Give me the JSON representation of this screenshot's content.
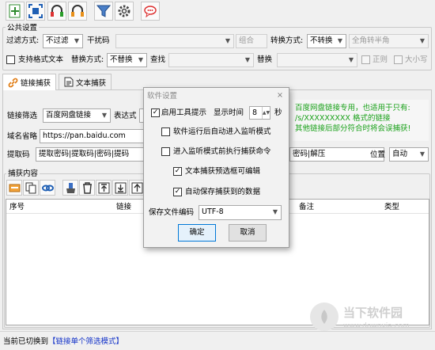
{
  "toolbar": {
    "icons": [
      "add-icon",
      "scan-icon",
      "headphones-red-icon",
      "headphones-orange-icon",
      "filter-icon",
      "gear-icon",
      "chat-icon"
    ]
  },
  "public_settings": {
    "title": "公共设置",
    "filter_mode_label": "过滤方式:",
    "filter_mode_value": "不过滤",
    "interference_label": "干扰码",
    "combine_value": "组合",
    "convert_mode_label": "转换方式:",
    "convert_mode_value": "不转换",
    "width_value": "全角转半角",
    "support_format_label": "支持格式文本",
    "replace_mode_label": "替换方式:",
    "replace_mode_value": "不替换",
    "find_label": "查找",
    "replace_label": "替换",
    "regex_label": "正则",
    "case_label": "大小写"
  },
  "tabs": [
    {
      "label": "链接捕获"
    },
    {
      "label": "文本捕获"
    }
  ],
  "link_capture": {
    "filter_label": "链接筛选",
    "filter_value": "百度网盘链接",
    "expr_label": "表达式",
    "domain_label": "域名省略",
    "domain_value": "https://pan.baidu.com",
    "code_label": "提取码",
    "code_value": "提取密码|提取码|密码|提码",
    "right_value": "密码|解压",
    "position_label": "位置",
    "position_value": "自动",
    "note_lines": [
      "百度网盘链接专用，也适用于只有:",
      "/s/XXXXXXXXX 格式的链接",
      "其他链接后部分符合时将会误捕获!"
    ]
  },
  "capture": {
    "title": "捕获内容",
    "columns": [
      "序号",
      "链接",
      "备注",
      "类型"
    ]
  },
  "dialog": {
    "title": "软件设置",
    "close": "×",
    "tooltip_label": "启用工具提示",
    "tooltip_checked": "✓",
    "display_time_label": "显示时间",
    "display_time_value": "8",
    "seconds_label": "秒",
    "auto_monitor_label": "软件运行后自动进入监听模式",
    "exec_capture_label": "进入监听模式前执行捕获命令",
    "preview_edit_label": "文本捕获预选框可编辑",
    "preview_edit_checked": "✓",
    "autosave_label": "自动保存捕获到的数据",
    "autosave_checked": "✓",
    "encoding_label": "保存文件编码",
    "encoding_value": "UTF-8",
    "ok": "确定",
    "cancel": "取消"
  },
  "status": {
    "prefix": "当前已切换到",
    "mode": "【链接单个筛选模式】"
  },
  "watermark": {
    "line1": "当下软件园",
    "line2": "www.downxia.com"
  }
}
